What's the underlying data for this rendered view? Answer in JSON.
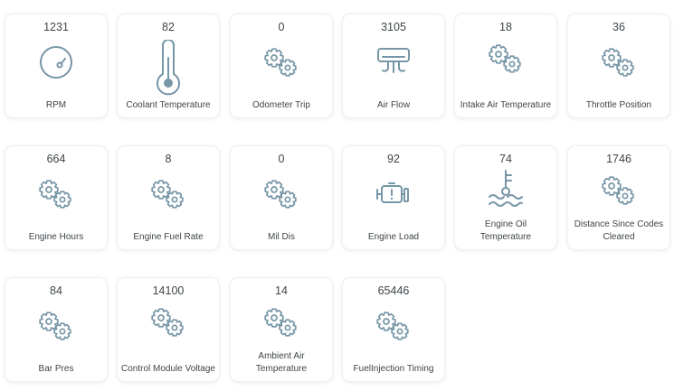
{
  "colors": {
    "icon": "#7796a6",
    "text": "#3f4549",
    "card_border": "#eef0f2",
    "background": "#ffffff"
  },
  "cards": [
    {
      "value": "1231",
      "label": "RPM",
      "icon": "gauge-icon"
    },
    {
      "value": "82",
      "label": "Coolant Temperature",
      "icon": "thermometer-icon"
    },
    {
      "value": "0",
      "label": "Odometer Trip",
      "icon": "gears-icon"
    },
    {
      "value": "3105",
      "label": "Air Flow",
      "icon": "air-flow-icon"
    },
    {
      "value": "18",
      "label": "Intake Air Temperature",
      "icon": "gears-icon"
    },
    {
      "value": "36",
      "label": "Throttle Position",
      "icon": "gears-icon"
    },
    {
      "value": "664",
      "label": "Engine Hours",
      "icon": "gears-icon"
    },
    {
      "value": "8",
      "label": "Engine Fuel Rate",
      "icon": "gears-icon"
    },
    {
      "value": "0",
      "label": "Mil Dis",
      "icon": "gears-icon"
    },
    {
      "value": "92",
      "label": "Engine Load",
      "icon": "engine-icon"
    },
    {
      "value": "74",
      "label": "Engine Oil Temperature",
      "icon": "oil-temperature-icon"
    },
    {
      "value": "1746",
      "label": "Distance Since Codes Cleared",
      "icon": "gears-icon"
    },
    {
      "value": "84",
      "label": "Bar Pres",
      "icon": "gears-icon"
    },
    {
      "value": "14100",
      "label": "Control Module Voltage",
      "icon": "gears-icon"
    },
    {
      "value": "14",
      "label": "Ambient Air Temperature",
      "icon": "gears-icon"
    },
    {
      "value": "65446",
      "label": "FuelInjection Timing",
      "icon": "gears-icon"
    }
  ]
}
